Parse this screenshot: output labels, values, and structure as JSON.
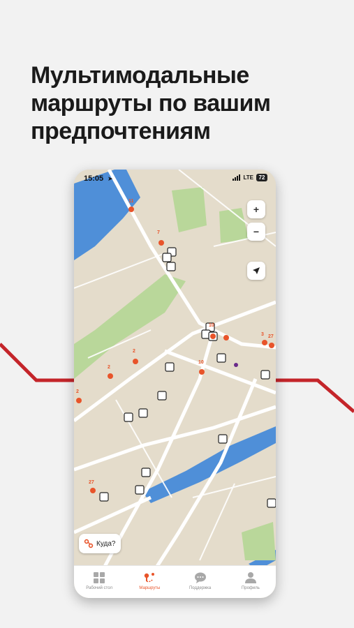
{
  "headline": {
    "line1": "Мультимодальные",
    "line2": "маршруты по вашим",
    "line3": "предпочтениям"
  },
  "status_bar": {
    "time": "15:05",
    "network": "LTE",
    "battery": "72"
  },
  "map": {
    "zoom_in_label": "+",
    "zoom_out_label": "−",
    "stop_counts": [
      "11",
      "7",
      "10",
      "10",
      "3",
      "27",
      "2",
      "2",
      "2",
      "27"
    ]
  },
  "search": {
    "label": "Куда?"
  },
  "tabs": [
    {
      "label": "Рабочий стол",
      "icon": "dashboard-icon"
    },
    {
      "label": "Маршруты",
      "icon": "route-icon",
      "active": true
    },
    {
      "label": "Поддержка",
      "icon": "chat-icon"
    },
    {
      "label": "Профиль",
      "icon": "profile-icon"
    }
  ],
  "colors": {
    "accent": "#e8542a",
    "red_line": "#c4252a",
    "water": "#4f8fd8",
    "park": "#b9d79a",
    "land": "#e4dccb"
  }
}
